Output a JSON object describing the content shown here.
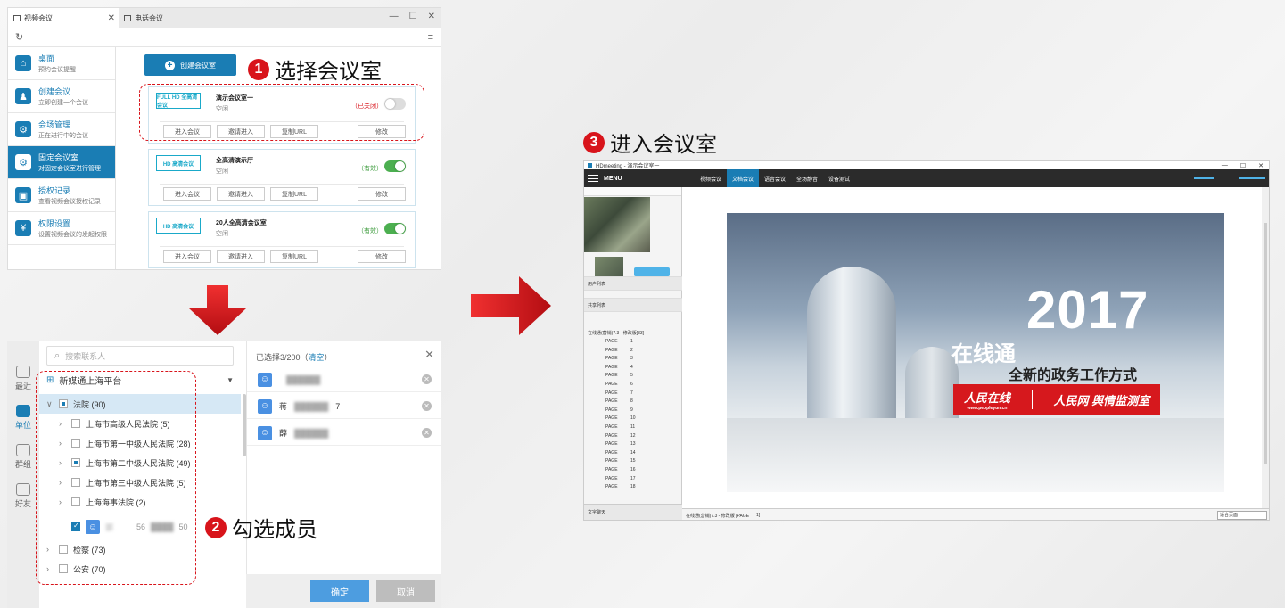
{
  "steps": [
    {
      "num": "1",
      "label": "选择会议室"
    },
    {
      "num": "2",
      "label": "勾选成员"
    },
    {
      "num": "3",
      "label": "进入会议室"
    }
  ],
  "panel1": {
    "tabs": [
      "视频会议",
      "电话会议"
    ],
    "refresh_icon": "refresh-icon",
    "menu_icon": "hamburger-icon",
    "sidebar": [
      {
        "title": "桌面",
        "desc": "预约会议提醒",
        "icon": "home-icon"
      },
      {
        "title": "创建会议",
        "desc": "立即创建一个会议",
        "icon": "create-meeting-icon"
      },
      {
        "title": "会场管理",
        "desc": "正在进行中的会议",
        "icon": "venue-icon"
      },
      {
        "title": "固定会议室",
        "desc": "对固定会议室进行管理",
        "icon": "fixed-room-icon"
      },
      {
        "title": "授权记录",
        "desc": "查看视频会议授权记录",
        "icon": "auth-record-icon"
      },
      {
        "title": "权限设置",
        "desc": "设置视频会议的发起权限",
        "icon": "permission-icon"
      }
    ],
    "create_btn": "创建会议室",
    "rooms": [
      {
        "logo": "FULL HD 全高清会议",
        "name": "演示会议室一",
        "status": "空闲",
        "state": "（已关闭）",
        "on": false
      },
      {
        "logo": "HD 高清会议",
        "name": "全高清演示厅",
        "status": "空闲",
        "state": "（有效）",
        "on": true
      },
      {
        "logo": "HD 高清会议",
        "name": "20人全高清会议室",
        "status": "空闲",
        "state": "（有效）",
        "on": true
      }
    ],
    "room_buttons": [
      "进入会议",
      "邀请进入",
      "复制URL",
      "修改"
    ]
  },
  "panel2": {
    "rail": [
      "最近",
      "单位",
      "群组",
      "好友"
    ],
    "search_placeholder": "搜索联系人",
    "org": "新媒通上海平台",
    "tree": [
      {
        "label": "法院 (90)"
      },
      {
        "label": "上海市高级人民法院 (5)"
      },
      {
        "label": "上海市第一中级人民法院 (28)"
      },
      {
        "label": "上海市第二中级人民法院 (49)"
      },
      {
        "label": "上海市第三中级人民法院 (5)"
      },
      {
        "label": "上海海事法院 (2)"
      },
      {
        "label": "检察 (73)"
      },
      {
        "label": "公安 (70)"
      }
    ],
    "person": {
      "name": "郭",
      "phone": "56",
      "phone_end": "50"
    },
    "selected_header": "已选择3/200（",
    "clear": "清空",
    "selected_header_end": "）",
    "selected": [
      "",
      "蒋",
      "薛"
    ],
    "selected_suffix": [
      "",
      "7",
      ""
    ],
    "ok": "确定",
    "cancel": "取消"
  },
  "panel3": {
    "title": "HDmeeting - 演示会议室一",
    "menu": "MENU",
    "tabs": [
      "视频会议",
      "文档会议",
      "语音会议",
      "全场静音",
      "设备测试"
    ],
    "sections": [
      "用户列表",
      "共享列表",
      "文字聊天"
    ],
    "doc": "在线通(营销)7.3 - 修改版[33]",
    "pages": [
      "1",
      "2",
      "3",
      "4",
      "5",
      "6",
      "7",
      "8",
      "9",
      "10",
      "11",
      "12",
      "13",
      "14",
      "15",
      "16",
      "17",
      "18"
    ],
    "page_label": "PAGE",
    "status": "在线通(营销)7.3 - 修改版 [PAGE",
    "status_page": "1]",
    "zoom": "适合页面",
    "slide": {
      "year": "2017",
      "brand": "在线通",
      "subtitle": "全新的政务工作方式",
      "logo1": "人民在线",
      "logo1_url": "www.peopleyun.cn",
      "logo2": "人民网 舆情监测室"
    }
  }
}
